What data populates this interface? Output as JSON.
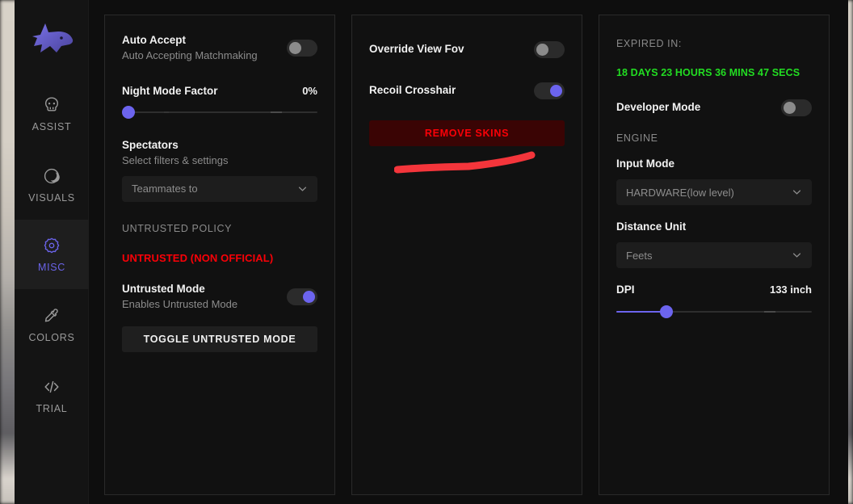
{
  "app": {
    "logo_icon": "wolf-head-logo",
    "accent_color": "#6c64ee",
    "danger_color": "#fb0007",
    "success_color": "#22dd22"
  },
  "sidebar": {
    "items": [
      {
        "label": "ASSIST",
        "icon": "skull-icon",
        "active": false
      },
      {
        "label": "VISUALS",
        "icon": "moon-circle-icon",
        "active": false
      },
      {
        "label": "MISC",
        "icon": "gear-icon",
        "active": true
      },
      {
        "label": "COLORS",
        "icon": "eyedropper-icon",
        "active": false
      },
      {
        "label": "TRIAL",
        "icon": "code-icon",
        "active": false
      }
    ]
  },
  "panel1": {
    "auto_accept": {
      "title": "Auto Accept",
      "subtitle": "Auto Accepting Matchmaking",
      "toggle_state": "off"
    },
    "night_mode": {
      "label": "Night Mode Factor",
      "value_text": "0%",
      "value": 0,
      "min": 0,
      "max": 100
    },
    "spectators": {
      "title": "Spectators",
      "subtitle": "Select filters & settings",
      "dropdown_value": "Teammates to",
      "dropdown_icon": "chevron-down-icon"
    },
    "untrusted_policy_label": "UNTRUSTED POLICY",
    "untrusted_status": "UNTRUSTED (NON OFFICIAL)",
    "untrusted_mode": {
      "title": "Untrusted Mode",
      "subtitle": "Enables Untrusted Mode",
      "toggle_state": "on"
    },
    "toggle_button": "TOGGLE UNTRUSTED MODE"
  },
  "panel2": {
    "override_view_fov": {
      "title": "Override View Fov",
      "toggle_state": "off"
    },
    "recoil_crosshair": {
      "title": "Recoil Crosshair",
      "toggle_state": "on"
    },
    "remove_skins_button": "REMOVE SKINS",
    "annotation": "red-scribble-underline"
  },
  "panel3": {
    "expired_label": "EXPIRED IN:",
    "expired_value": "18 DAYS 23 HOURS 36 MINS 47 SECS",
    "developer_mode": {
      "title": "Developer Mode",
      "toggle_state": "off"
    },
    "engine_label": "ENGINE",
    "input_mode": {
      "label": "Input Mode",
      "dropdown_value": "HARDWARE(low level)",
      "dropdown_icon": "chevron-down-icon"
    },
    "distance_unit": {
      "label": "Distance Unit",
      "dropdown_value": "Feets",
      "dropdown_icon": "chevron-down-icon"
    },
    "dpi": {
      "label": "DPI",
      "value_text": "133 inch",
      "value": 133,
      "min": 0,
      "max": 500
    }
  }
}
